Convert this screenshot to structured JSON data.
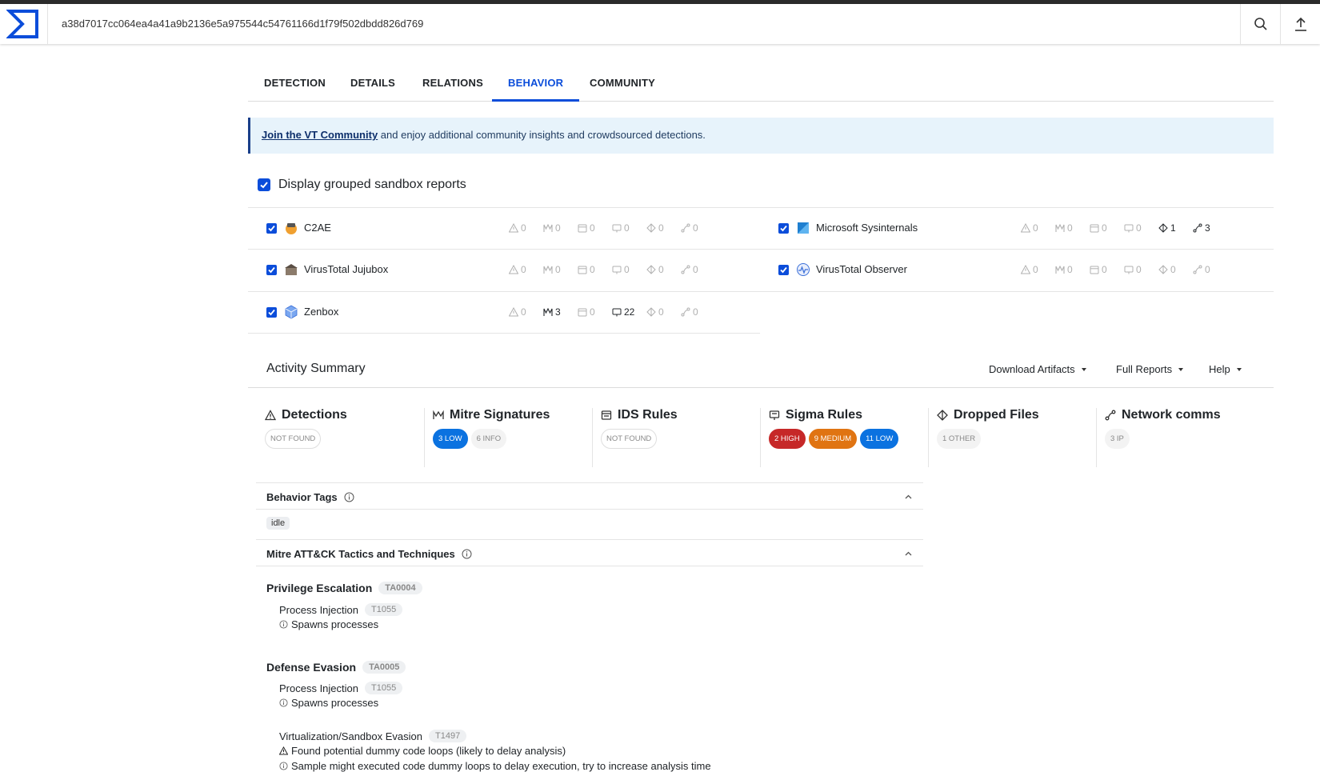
{
  "header": {
    "hash": "a38d7017cc064ea4a41a9b2136e5a975544c54761166d1f79f502dbdd826d769"
  },
  "tabs": [
    {
      "label": "DETECTION"
    },
    {
      "label": "DETAILS"
    },
    {
      "label": "RELATIONS"
    },
    {
      "label": "BEHAVIOR"
    },
    {
      "label": "COMMUNITY"
    }
  ],
  "banner": {
    "link": "Join the VT Community",
    "text": " and enjoy additional community insights and crowdsourced detections."
  },
  "grouped": {
    "label": "Display grouped sandbox reports",
    "checked": true
  },
  "sandboxes": [
    {
      "name": "C2AE",
      "stats": [
        "0",
        "0",
        "0",
        "0",
        "0",
        "0"
      ]
    },
    {
      "name": "Microsoft Sysinternals",
      "stats": [
        "0",
        "0",
        "0",
        "0",
        "1",
        "3"
      ]
    },
    {
      "name": "VirusTotal Jujubox",
      "stats": [
        "0",
        "0",
        "0",
        "0",
        "0",
        "0"
      ]
    },
    {
      "name": "VirusTotal Observer",
      "stats": [
        "0",
        "0",
        "0",
        "0",
        "0",
        "0"
      ]
    },
    {
      "name": "Zenbox",
      "stats": [
        "0",
        "3",
        "0",
        "22",
        "0",
        "0"
      ]
    }
  ],
  "activity": {
    "title": "Activity Summary",
    "download": "Download Artifacts",
    "full_reports": "Full Reports",
    "help": "Help"
  },
  "cards": [
    {
      "title": "Detections",
      "badges": [
        "NOT FOUND"
      ]
    },
    {
      "title": "Mitre Signatures",
      "badges": [
        "3 LOW",
        "6 INFO"
      ]
    },
    {
      "title": "IDS Rules",
      "badges": [
        "NOT FOUND"
      ]
    },
    {
      "title": "Sigma Rules",
      "badges": [
        "2 HIGH",
        "9 MEDIUM",
        "11 LOW"
      ]
    },
    {
      "title": "Dropped Files",
      "badges": [
        "1 OTHER"
      ]
    },
    {
      "title": "Network comms",
      "badges": [
        "3 IP"
      ]
    }
  ],
  "behavior_tags": {
    "title": "Behavior Tags",
    "tags": [
      "idle"
    ]
  },
  "mitre": {
    "title": "Mitre ATT&CK Tactics and Techniques",
    "tactics": [
      {
        "name": "Privilege Escalation",
        "id": "TA0004",
        "techniques": [
          {
            "name": "Process Injection",
            "id": "T1055",
            "signatures": [
              "Spawns processes"
            ]
          }
        ]
      },
      {
        "name": "Defense Evasion",
        "id": "TA0005",
        "techniques": [
          {
            "name": "Process Injection",
            "id": "T1055",
            "signatures": [
              "Spawns processes"
            ]
          },
          {
            "name": "Virtualization/Sandbox Evasion",
            "id": "T1497",
            "signatures": [
              "Found potential dummy code loops (likely to delay analysis)",
              "Sample might executed code dummy loops to delay execution, try to increase analysis time"
            ]
          }
        ]
      }
    ]
  },
  "colors": {
    "accent": "#0b4dda",
    "low": "#0b72e0",
    "high": "#c62828",
    "medium": "#e07412"
  }
}
